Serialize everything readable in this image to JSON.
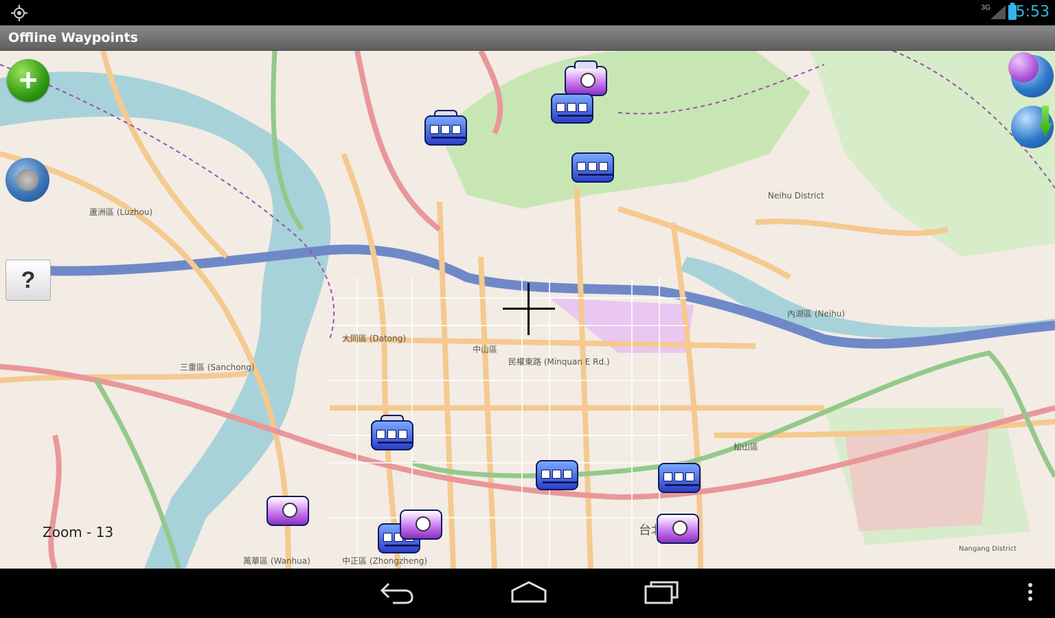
{
  "status_bar": {
    "clock": "5:53",
    "signal_label": "3G"
  },
  "title_bar": {
    "title": "Offline Waypoints"
  },
  "map": {
    "zoom_text": "Zoom - 13",
    "labels": {
      "luzhou": "蘆洲區 (Luzhou)",
      "datong": "大同區 (Datong)",
      "zhongshan": "中山區",
      "sanchong": "三重區 (Sanchong)",
      "neihu": "內湖區 (Neihu)",
      "neihu_district": "Neihu District",
      "wanhua": "萬華區 (Wanhua)",
      "zhongzheng": "中正區 (Zhongzheng)",
      "taipei": "台北",
      "minquan": "民權東路 (Minquan E Rd.)",
      "songshan": "松山區",
      "nangang": "Nangang District"
    }
  },
  "buttons": {
    "add": "+",
    "help": "?"
  },
  "navbar": {
    "back": "back",
    "home": "home",
    "recents": "recents",
    "menu": "menu"
  }
}
